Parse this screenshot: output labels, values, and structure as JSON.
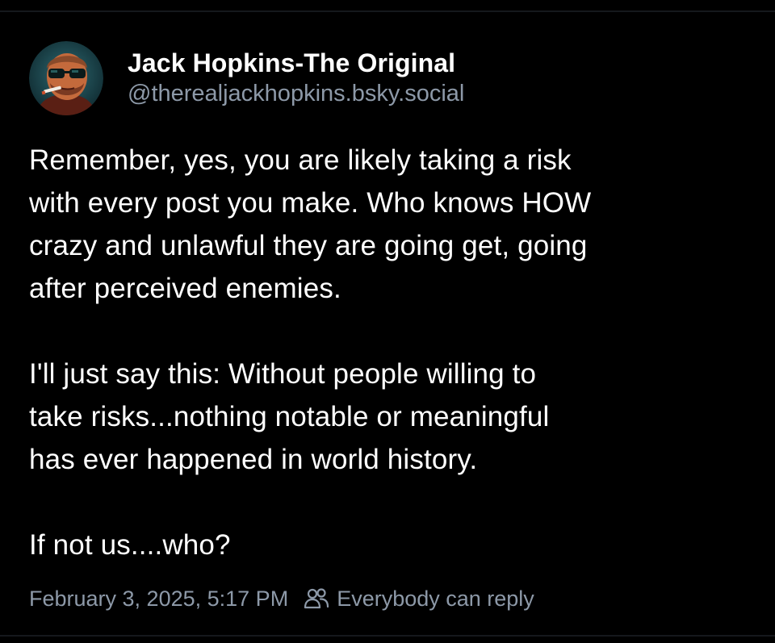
{
  "post": {
    "author": {
      "display_name": "Jack Hopkins-The Original",
      "handle": "@therealjackhopkins.bsky.social",
      "avatar_icon": "avatar-photo"
    },
    "text": "Remember, yes, you are likely taking a risk\nwith every post you make. Who knows HOW\ncrazy and unlawful they are going get, going\nafter perceived enemies.\n\nI'll just say this: Without people willing to\ntake risks...nothing notable or meaningful\nhas ever happened in world history.\n\nIf not us....who?",
    "timestamp": "February 3, 2025, 5:17 PM",
    "reply_setting": {
      "icon": "people-icon",
      "label": "Everybody can reply"
    }
  },
  "colors": {
    "background": "#000000",
    "text": "#ffffff",
    "muted": "#8d99a8",
    "divider": "#15181c"
  }
}
